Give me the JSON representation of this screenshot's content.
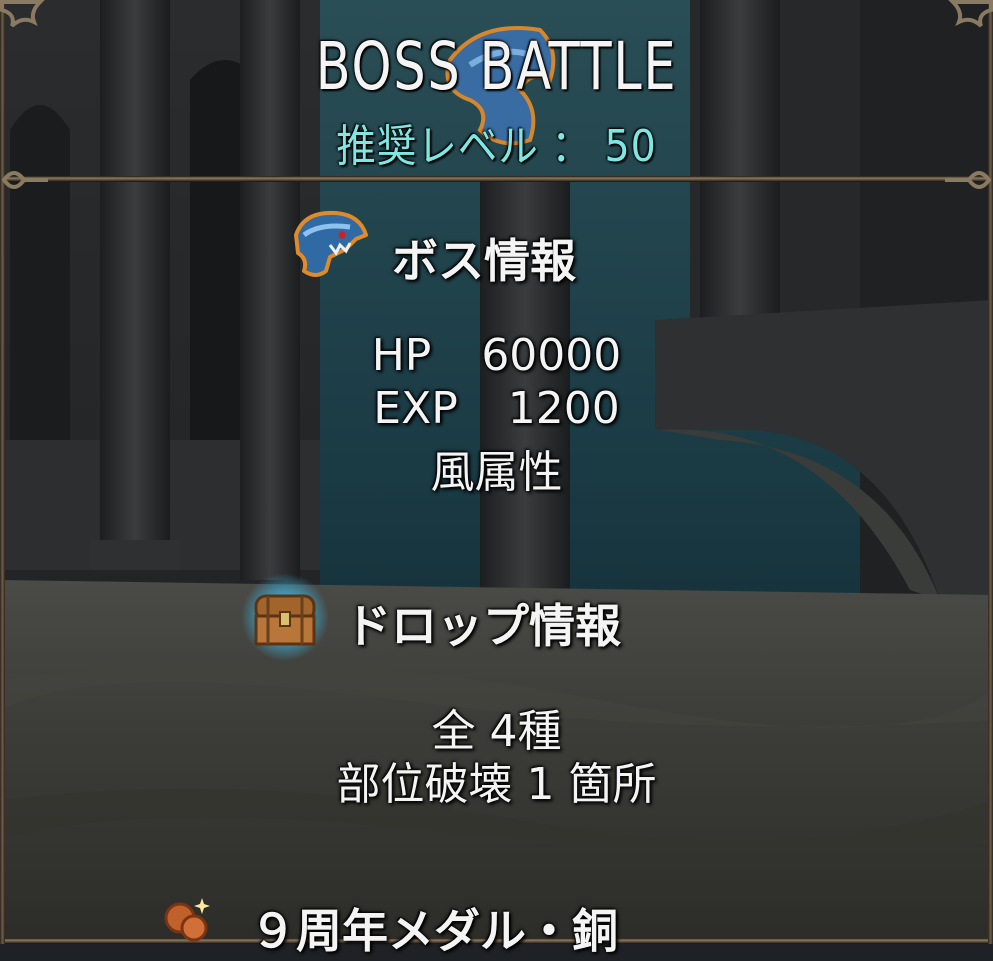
{
  "header": {
    "title": "BOSS  BATTLE",
    "level_label": "推奨レベル",
    "level_sep": "：",
    "level_value": "50"
  },
  "boss_info": {
    "heading": "ボス情報",
    "hp_label": "HP",
    "hp_value": "60000",
    "exp_label": "EXP",
    "exp_value": "1200",
    "attribute": "風属性"
  },
  "drop_info": {
    "heading": "ドロップ情報",
    "total": "全 4種",
    "part_break": "部位破壊 1 箇所",
    "item_name": "９周年メダル・銅"
  },
  "icons": {
    "boss": "shark-monster-icon",
    "drop": "treasure-chest-icon",
    "medal": "medal-icon"
  },
  "colors": {
    "level_text": "#7fe7e3",
    "text": "#f4f4f4",
    "frame": "#8a7a62"
  }
}
